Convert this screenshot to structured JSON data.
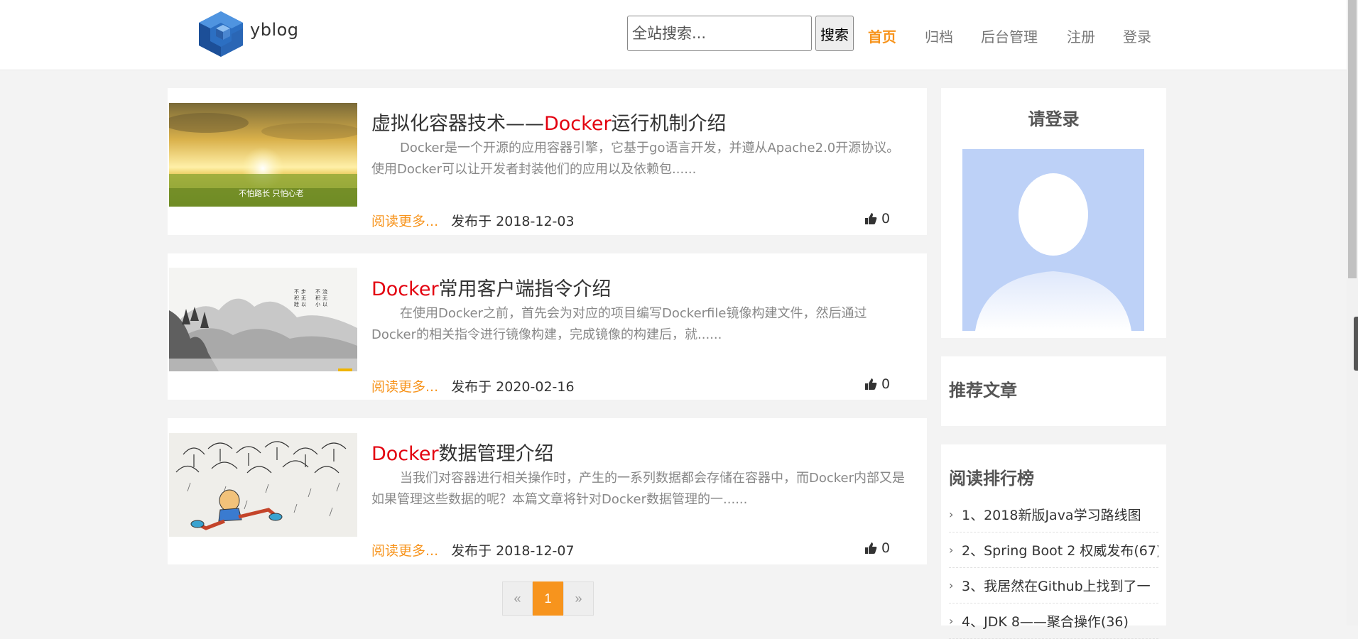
{
  "header": {
    "logo_text": "yblog",
    "search_placeholder": "全站搜索...",
    "search_button": "搜索",
    "nav": [
      {
        "label": "首页",
        "active": true
      },
      {
        "label": "归档",
        "active": false
      },
      {
        "label": "后台管理",
        "active": false
      },
      {
        "label": "注册",
        "active": false
      },
      {
        "label": "登录",
        "active": false
      }
    ]
  },
  "posts": [
    {
      "title_pre": "虚拟化容器技术——",
      "title_hl": "Docker",
      "title_post": "运行机制介绍",
      "summary": "Docker是一个开源的应用容器引擎，它基于go语言开发，并遵从Apache2.0开源协议。使用Docker可以让开发者封装他们的应用以及依赖包......",
      "read_more": "阅读更多...",
      "date": "发布于 2018-12-03",
      "likes": "0",
      "thumb_caption": "不怕路长 只怕心老"
    },
    {
      "title_pre": "",
      "title_hl": "Docker",
      "title_post": "常用客户端指令介绍",
      "summary": "在使用Docker之前，首先会为对应的项目编写Dockerfile镜像构建文件，然后通过Docker的相关指令进行镜像构建，完成镜像的构建后，就......",
      "read_more": "阅读更多...",
      "date": "发布于 2020-02-16",
      "likes": "0",
      "thumb_caption": ""
    },
    {
      "title_pre": "",
      "title_hl": "Docker",
      "title_post": "数据管理介绍",
      "summary": "当我们对容器进行相关操作时，产生的一系列数据都会存储在容器中，而Docker内部又是如果管理这些数据的呢？本篇文章将针对Docker数据管理的一......",
      "read_more": "阅读更多...",
      "date": "发布于 2018-12-07",
      "likes": "0",
      "thumb_caption": ""
    }
  ],
  "pagination": {
    "prev": "«",
    "current": "1",
    "next": "»"
  },
  "sidebar": {
    "login_title": "请登录",
    "recommended_title": "推荐文章",
    "ranking_title": "阅读排行榜",
    "ranking": [
      "1、2018新版Java学习路线图",
      "2、Spring Boot 2 权威发布(67)",
      "3、我居然在Github上找到了一",
      "4、JDK 8——聚合操作(36)"
    ]
  },
  "colors": {
    "accent": "#f7941d",
    "highlight": "#e3000f",
    "avatar_bg": "#bdd1f7"
  }
}
